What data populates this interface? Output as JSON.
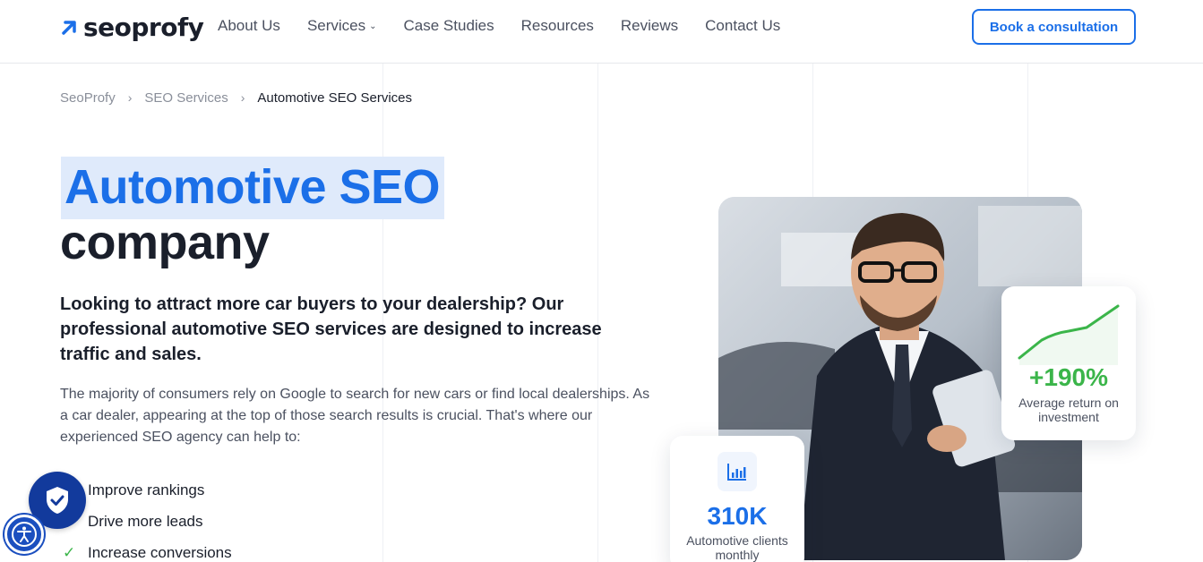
{
  "brand": {
    "name": "seoprofy",
    "accent": "#1b6fe8"
  },
  "nav": {
    "items": [
      {
        "label": "About Us",
        "has_dropdown": false
      },
      {
        "label": "Services",
        "has_dropdown": true
      },
      {
        "label": "Case Studies",
        "has_dropdown": false
      },
      {
        "label": "Resources",
        "has_dropdown": false
      },
      {
        "label": "Reviews",
        "has_dropdown": false
      },
      {
        "label": "Contact Us",
        "has_dropdown": false
      }
    ],
    "cta_label": "Book a consultation"
  },
  "breadcrumb": {
    "items": [
      "SeoProfy",
      "SEO Services",
      "Automotive SEO Services"
    ],
    "separator": "›"
  },
  "hero": {
    "title_highlight": "Automotive SEO",
    "title_rest": "company",
    "lead": "Looking to attract more car buyers to your dealership? Our professional automotive SEO services are designed to increase traffic and sales.",
    "paragraph": "The majority of consumers rely on Google to search for new cars or find local dealerships. As a car dealer, appearing at the top of those search results is crucial. That's where our experienced SEO agency can help to:",
    "benefits": [
      "Improve rankings",
      "Drive more leads",
      "Increase conversions"
    ]
  },
  "stats": {
    "roi": {
      "value": "+190%",
      "label": "Average return on investment",
      "color": "#3bb54a"
    },
    "clients": {
      "value": "310K",
      "label": "Automotive clients monthly",
      "color": "#1b6fe8"
    }
  }
}
